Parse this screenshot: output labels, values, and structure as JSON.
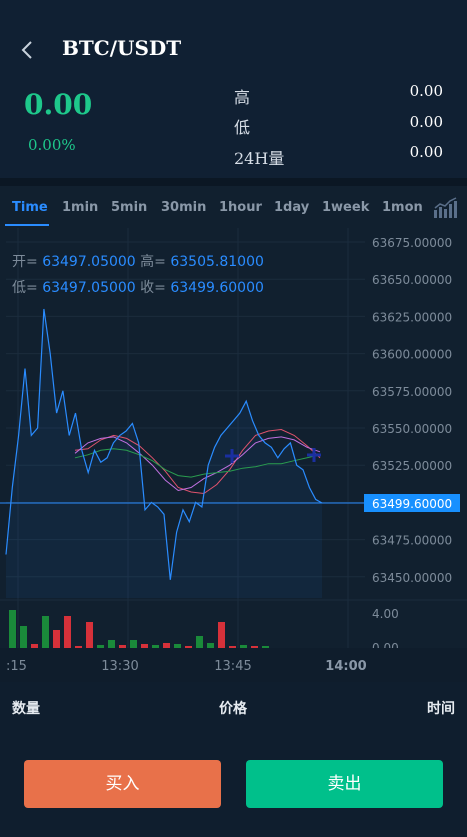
{
  "header": {
    "pair": "BTC/USDT",
    "price": "0.00",
    "change": "0.00%",
    "stats": [
      {
        "label": "高",
        "value": "0.00"
      },
      {
        "label": "低",
        "value": "0.00"
      },
      {
        "label": "24H量",
        "value": "0.00"
      }
    ]
  },
  "tabs": [
    "Time",
    "1min",
    "5min",
    "30min",
    "1hour",
    "1day",
    "1week",
    "1mon"
  ],
  "active_tab": "Time",
  "ohlc": {
    "open_label": "开=",
    "open": "63497.05000",
    "high_label": "高=",
    "high": "63505.81000",
    "low_label": "低=",
    "low": "63497.05000",
    "close_label": "收=",
    "close": "63499.60000"
  },
  "chart_data": {
    "type": "line",
    "y_ticks": [
      "63675.00000",
      "63650.00000",
      "63625.00000",
      "63600.00000",
      "63575.00000",
      "63550.00000",
      "63525.00000",
      "63500.00000",
      "63475.00000",
      "63450.00000"
    ],
    "ylim": [
      63445,
      63675
    ],
    "current_price": "63499.60000",
    "x_ticks": [
      ":15",
      "13:30",
      "13:45",
      "14:00"
    ],
    "price_series": [
      63465,
      63510,
      63545,
      63590,
      63545,
      63550,
      63630,
      63600,
      63560,
      63575,
      63545,
      63560,
      63535,
      63520,
      63535,
      63527,
      63530,
      63540,
      63545,
      63548,
      63553,
      63540,
      63495,
      63500,
      63497,
      63492,
      63448,
      63480,
      63495,
      63487,
      63500,
      63497,
      63525,
      63537,
      63545,
      63550,
      63555,
      63560,
      63568,
      63555,
      63545,
      63540,
      63537,
      63530,
      63536,
      63540,
      63525,
      63522,
      63510,
      63502,
      63499.6
    ],
    "ma_series": [
      {
        "color": "#e0536d",
        "values": [
          63535,
          63536,
          63542,
          63545,
          63543,
          63538,
          63530,
          63521,
          63510,
          63507,
          63506,
          63512,
          63522,
          63535,
          63545,
          63548,
          63549,
          63545,
          63538,
          63530
        ]
      },
      {
        "color": "#c070e0",
        "values": [
          63533,
          63540,
          63543,
          63544,
          63540,
          63533,
          63525,
          63515,
          63508,
          63510,
          63516,
          63520,
          63525,
          63532,
          63540,
          63543,
          63544,
          63542,
          63537,
          63534
        ]
      },
      {
        "color": "#2a9d4f",
        "values": [
          63530,
          63532,
          63535,
          63536,
          63535,
          63532,
          63528,
          63522,
          63518,
          63517,
          63519,
          63520,
          63521,
          63523,
          63524,
          63526,
          63526,
          63528,
          63530,
          63532
        ]
      }
    ],
    "volume_ticks": [
      "4.00",
      "0.00"
    ],
    "volume_bars": [
      {
        "v": 3.8,
        "color": "#1a8a3a"
      },
      {
        "v": 2.2,
        "color": "#1a8a3a"
      },
      {
        "v": 0.4,
        "color": "#d6313a"
      },
      {
        "v": 3.2,
        "color": "#1a8a3a"
      },
      {
        "v": 1.8,
        "color": "#d6313a"
      },
      {
        "v": 3.2,
        "color": "#d6313a"
      },
      {
        "v": 0.2,
        "color": "#d6313a"
      },
      {
        "v": 2.6,
        "color": "#d6313a"
      },
      {
        "v": 0.3,
        "color": "#1a8a3a"
      },
      {
        "v": 0.8,
        "color": "#1a8a3a"
      },
      {
        "v": 0.3,
        "color": "#d6313a"
      },
      {
        "v": 0.8,
        "color": "#1a8a3a"
      },
      {
        "v": 0.4,
        "color": "#d6313a"
      },
      {
        "v": 0.3,
        "color": "#1a8a3a"
      },
      {
        "v": 0.5,
        "color": "#d6313a"
      },
      {
        "v": 0.4,
        "color": "#1a8a3a"
      },
      {
        "v": 0.2,
        "color": "#d6313a"
      },
      {
        "v": 1.2,
        "color": "#1a8a3a"
      },
      {
        "v": 0.5,
        "color": "#1a8a3a"
      },
      {
        "v": 2.6,
        "color": "#d6313a"
      },
      {
        "v": 0.2,
        "color": "#d6313a"
      },
      {
        "v": 0.3,
        "color": "#1a8a3a"
      },
      {
        "v": 0.2,
        "color": "#d6313a"
      },
      {
        "v": 0.2,
        "color": "#1a8a3a"
      }
    ],
    "volume_max": 4
  },
  "list_header": {
    "qty": "数量",
    "price": "价格",
    "time": "时间"
  },
  "actions": {
    "buy": "买入",
    "sell": "卖出"
  },
  "colors": {
    "up": "#1ec88b",
    "down": "#e8714a",
    "accent": "#2a8cff"
  }
}
